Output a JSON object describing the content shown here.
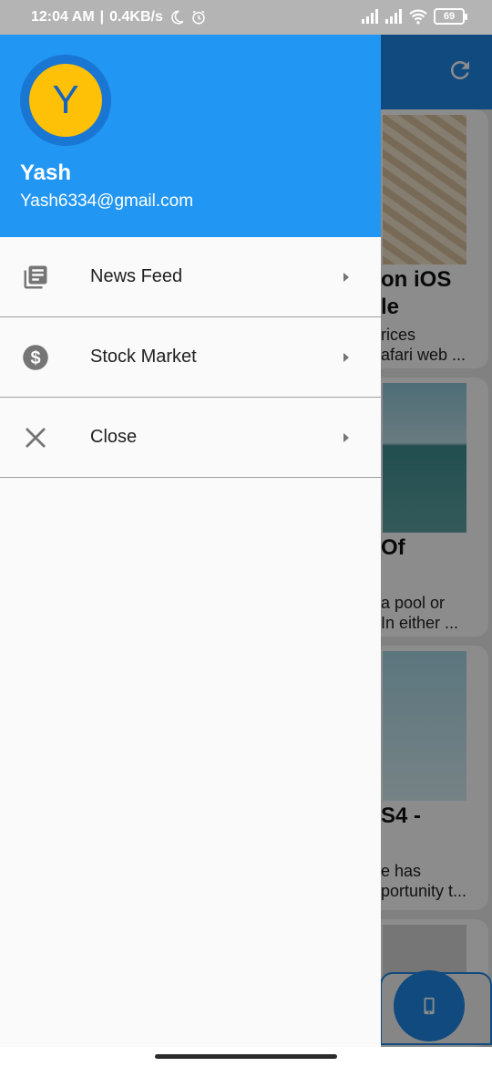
{
  "status_bar": {
    "time": "12:04 AM",
    "separator": "|",
    "speed": "0.4KB/s",
    "battery": "69",
    "icons": [
      "moon-icon",
      "alarm-icon",
      "signal-icon",
      "signal-icon",
      "wifi-icon",
      "battery-icon"
    ]
  },
  "drawer": {
    "avatar_letter": "Y",
    "user_name": "Yash",
    "user_email": "Yash6334@gmail.com",
    "items": [
      {
        "label": "News Feed",
        "icon": "news-icon"
      },
      {
        "label": "Stock Market",
        "icon": "dollar-icon"
      },
      {
        "label": "Close",
        "icon": "close-icon"
      }
    ],
    "arrow_icon": "arrow-right-icon"
  },
  "background": {
    "appbar_icon": "refresh-icon",
    "fab_icon": "phone-icon",
    "cards": [
      {
        "title": "on iOS\nle",
        "desc": "rices\nafari web ..."
      },
      {
        "title": "Of",
        "desc": "a pool or\nIn either ..."
      },
      {
        "title": "S4 -",
        "desc": "e has\nportunity t..."
      },
      {
        "title": "",
        "desc": ""
      }
    ]
  },
  "colors": {
    "header_blue": "#2196f3",
    "avatar_yellow": "#ffc107",
    "avatar_ring": "#1976d2",
    "appbar_blue": "#1e88e5"
  }
}
